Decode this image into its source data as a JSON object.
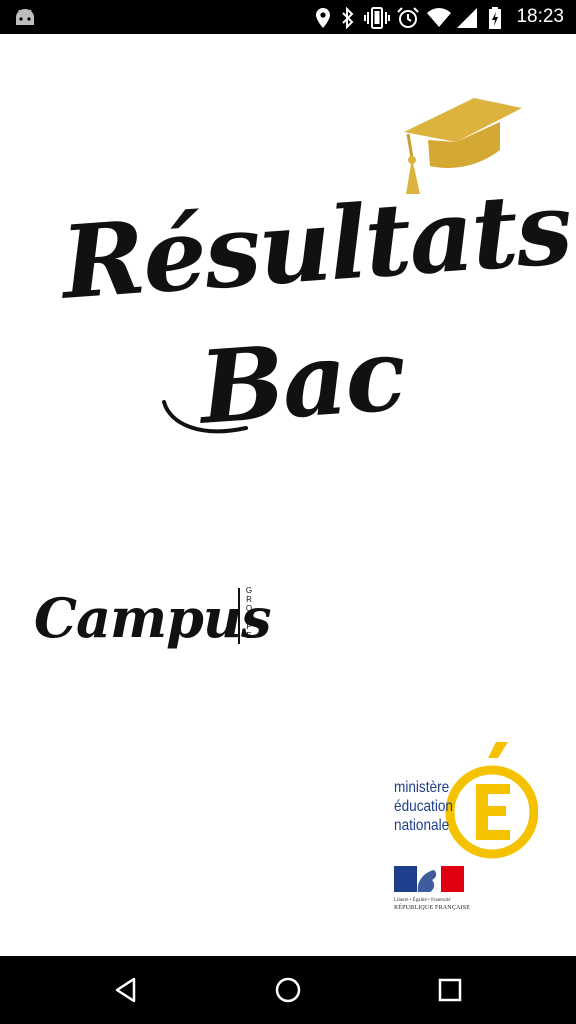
{
  "status_bar": {
    "time": "18:23",
    "icons": [
      "android-icon",
      "location-icon",
      "bluetooth-icon",
      "vibrate-icon",
      "alarm-icon",
      "wifi-icon",
      "signal-icon",
      "battery-charging-icon"
    ]
  },
  "splash": {
    "title_line1": "Résultats",
    "title_line2": "Bac",
    "campus_logo": "Campus",
    "campus_sub": "GROUPE",
    "ministere_lines": [
      "ministère",
      "éducation",
      "nationale"
    ],
    "ministere_letter": "É",
    "rf_motto": "Liberté • Égalité • Fraternité",
    "rf_name": "RÉPUBLIQUE FRANÇAISE"
  },
  "colors": {
    "accent_gold": "#DDB33F",
    "logo_yellow": "#F5C200",
    "ministere_blue": "#1E3F8C",
    "flag_red": "#E1000F"
  },
  "nav_bar": {
    "buttons": [
      "back",
      "home",
      "recents"
    ]
  }
}
